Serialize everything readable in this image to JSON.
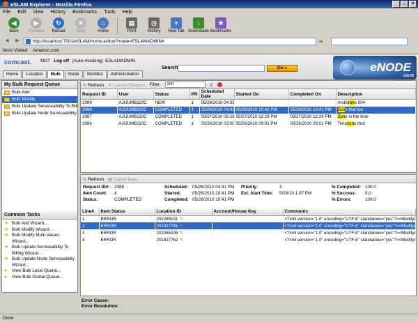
{
  "window": {
    "title": "eSLAM Explorer - Mozilla Firefox",
    "btn_min": "_",
    "btn_max": "□",
    "btn_close": "×"
  },
  "menu": [
    "File",
    "Edit",
    "View",
    "History",
    "Bookmarks",
    "Tools",
    "Help"
  ],
  "toolbar": [
    {
      "label": "Back",
      "icon": "back-arrow-icon",
      "color": "#3a8c2e",
      "glyph": "◀",
      "disabled": false
    },
    {
      "label": "Forward",
      "icon": "forward-arrow-icon",
      "color": "#b0b0b0",
      "glyph": "▶",
      "disabled": true
    },
    {
      "label": "Reload",
      "icon": "reload-icon",
      "color": "#2a6fd0",
      "glyph": "↻",
      "disabled": false
    },
    {
      "label": "Stop",
      "icon": "stop-icon",
      "color": "#b8b8b8",
      "glyph": "✕",
      "disabled": true
    },
    {
      "label": "Home",
      "icon": "home-icon",
      "color": "#4a79c0",
      "glyph": "⌂",
      "disabled": false
    },
    {
      "label": "Print",
      "icon": "print-icon",
      "color": "#6a6a6a",
      "glyph": "▤",
      "disabled": false
    },
    {
      "label": "History",
      "icon": "history-icon",
      "color": "#6a6a6a",
      "glyph": "◷",
      "disabled": false
    },
    {
      "label": "New Tab",
      "icon": "new-tab-icon",
      "color": "#4a79c0",
      "glyph": "+",
      "disabled": false
    },
    {
      "label": "Downloads",
      "icon": "downloads-icon",
      "color": "#3a8c2e",
      "glyph": "↓",
      "disabled": false
    },
    {
      "label": "Bookmarks",
      "icon": "bookmarks-icon",
      "color": "#7a5cc0",
      "glyph": "★",
      "disabled": false
    }
  ],
  "address": {
    "url": "http://localhost:7001/eSLAM/home.action?mode=ESLAMADMIN#"
  },
  "bookmarks": [
    "Most Visited",
    "Amazon.com"
  ],
  "app": {
    "brand": "comcast.",
    "user_line": [
      "MDT",
      "Log off",
      "[Auto-mocking]: ESLAMADMIN"
    ],
    "search_label": "Search:",
    "go_label": "Go »",
    "logo_text": "eNODE",
    "logo_version": "v10.05"
  },
  "tabs": [
    "Home",
    "Location",
    "Bulk",
    "Node",
    "Worklist",
    "Administration"
  ],
  "active_tab": "Bulk",
  "queue": {
    "title": "My Bulk Request Queue",
    "items": [
      "Bulk Add",
      "Bulk Modify",
      "Bulk Update Serviceability To Billing",
      "Bulk Update Node Serviceability"
    ],
    "selected": "Bulk Modify"
  },
  "tasks": {
    "title": "Common Tasks",
    "items": [
      "Bulk Add Wizard...",
      "Bulk Modify Wizard...",
      "Bulk Modify Multi-Values Wizard...",
      "Bulk Update Serviceability To Billing Wizard...",
      "Bulk Update Node Serviceability Wizard...",
      "View Bulk Local Queue...",
      "View Bulk Global Queue..."
    ]
  },
  "requests": {
    "refresh": "Refresh",
    "cancel": "Cancel Request",
    "filter_label": "Filter:",
    "filter_value": "zon",
    "columns": [
      "Request ID",
      "User",
      "Status",
      "PR",
      "Scheduled Date",
      "Started On",
      "Completed On",
      "Description"
    ],
    "rows": [
      [
        "2089",
        "AJIJUMB110C",
        "NEW",
        "1",
        "05/28/2010 04:05 PM",
        "",
        "",
        "Archizone 004"
      ],
      [
        "2088",
        "AJIJUMB110C",
        "COMPLETED",
        "3",
        "05/26/2010 04:41 PM",
        "05/26/2010 10:41 PM",
        "05/26/2010 10:41 PM",
        "Zone that too"
      ],
      [
        "2087",
        "AJIJUMB110C",
        "COMPLETED",
        "1",
        "05/27/2010 06:29 AM",
        "05/27/2010 12:29 PM",
        "05/27/2010 12:29 PM",
        "Zone in the time"
      ],
      [
        "2086",
        "AJIJUMB110C",
        "COMPLETED",
        "1",
        "05/26/2010 03:00 PM",
        "05/26/2010 09:01 PM",
        "05/26/2010 09:01 PM",
        "Timezone this!"
      ]
    ],
    "selected_index": 1
  },
  "detail": {
    "refresh": "Refresh",
    "export": "Export Data",
    "labels": {
      "request_id": "Request ID#:",
      "item_count": "Item Count:",
      "status": "Status:",
      "scheduled": "Scheduled:",
      "started": "Started:",
      "completed": "Completed:",
      "priority": "Priority:",
      "est_start": "Est. Start Time:",
      "pct_completed": "% Completed:",
      "pct_success": "% Success:",
      "pct_errors": "% Errors:"
    },
    "values": {
      "request_id": "2088",
      "item_count": "4",
      "status": "COMPLETED",
      "scheduled": "05/26/2010 04:41 PM",
      "started": "05/26/2010 10:41 PM",
      "completed": "05/26/2010 10:41 PM",
      "priority": "3",
      "est_start": "5/28/10 1:07 PM",
      "pct_completed": "100.0",
      "pct_success": "0.0",
      "pct_errors": "100.0"
    },
    "columns": [
      "Line#",
      "Item Status",
      "Location ID",
      "Account/House Key",
      "Comments"
    ],
    "rows": [
      [
        "1",
        "ERROR",
        "202265131",
        "",
        "<?xml version=\"1.0\" encoding=\"UTF-8\" standalone=\"yes\"?><ModifyL"
      ],
      [
        "2",
        "ERROR",
        "201827761",
        "",
        "<?xml version=\"1.0\" encoding=\"UTF-8\" standalone=\"yes\"?><ModifyL"
      ],
      [
        "3",
        "ERROR",
        "202265206",
        "",
        "<?xml version=\"1.0\" encoding=\"UTF-8\" standalone=\"yes\"?><ModifyL"
      ],
      [
        "4",
        "ERROR",
        "201827762",
        "",
        "<?xml version=\"1.0\" encoding=\"UTF-8\" standalone=\"yes\"?><ModifyL"
      ]
    ],
    "selected_index": 1,
    "error_cause": "Error Cause:",
    "error_resolution": "Error Resolution:"
  },
  "status_bar": "Done",
  "colors": {
    "selection": "#316ac5",
    "highlight": "#ffe600",
    "title_bar": "#0a246a"
  }
}
